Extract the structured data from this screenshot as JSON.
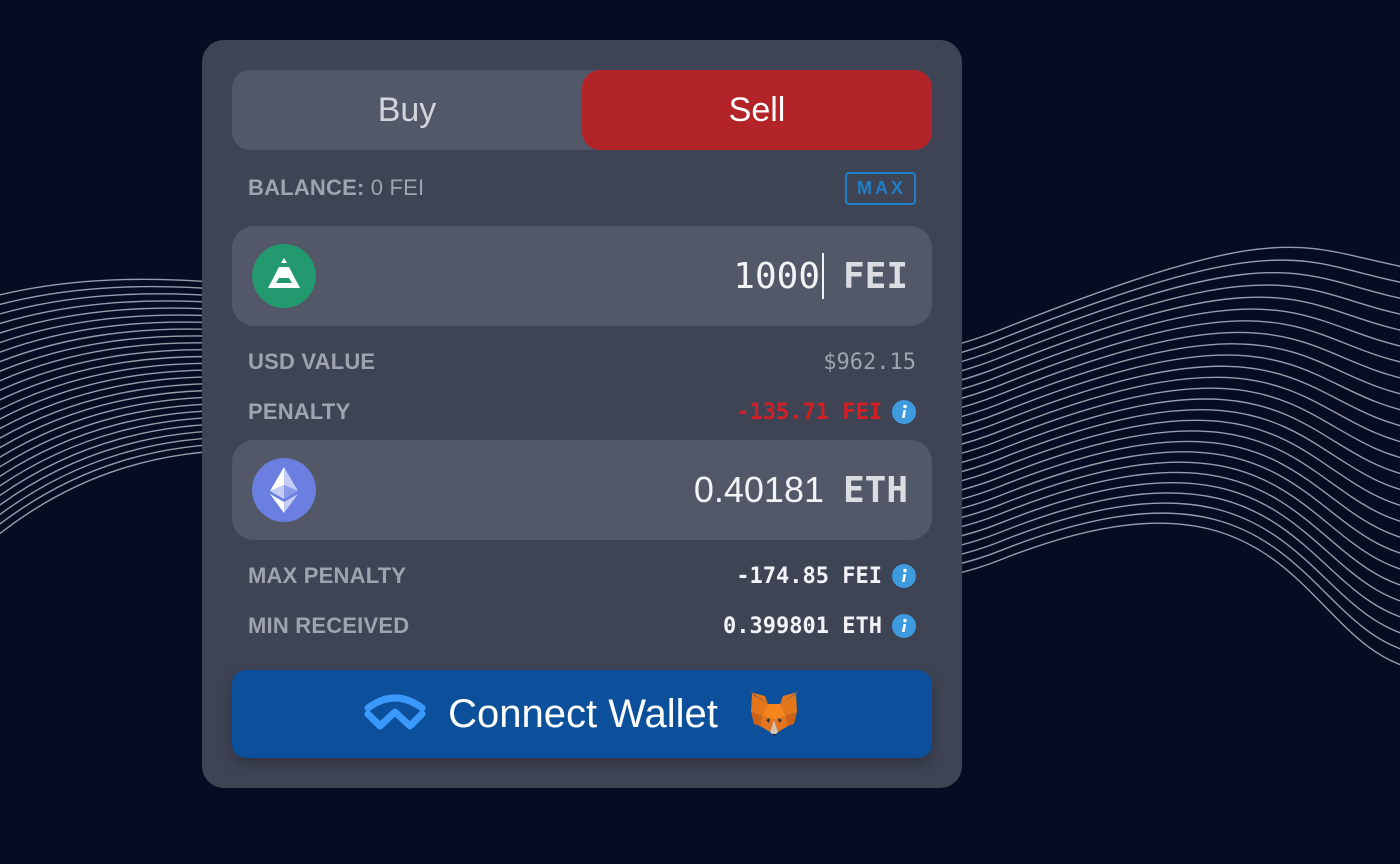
{
  "trade": {
    "buy_label": "Buy",
    "sell_label": "Sell",
    "active_tab": "Sell"
  },
  "balance": {
    "label": "BALANCE:",
    "value": "0 FEI",
    "max_label": "MAX"
  },
  "input_token": {
    "icon": "fei-logo-icon",
    "amount": "1000",
    "symbol": "FEI"
  },
  "usd_value": {
    "label": "USD VALUE",
    "value": "$962.15"
  },
  "penalty": {
    "label": "PENALTY",
    "value": "-135.71 FEI"
  },
  "output_token": {
    "icon": "eth-logo-icon",
    "amount": "0.40181",
    "symbol": "ETH"
  },
  "max_penalty": {
    "label": "MAX PENALTY",
    "value": "-174.85 FEI"
  },
  "min_received": {
    "label": "MIN RECEIVED",
    "value": "0.399801 ETH"
  },
  "connect": {
    "label": "Connect Wallet",
    "left_icon": "walletconnect-icon",
    "right_icon": "metamask-fox-icon"
  },
  "colors": {
    "background": "#070c22",
    "card": "#3f4455",
    "sell_active": "#b22428",
    "connect_button": "#0c4f9a",
    "penalty_red": "#d21f24",
    "max_blue": "#1f7fc6"
  }
}
